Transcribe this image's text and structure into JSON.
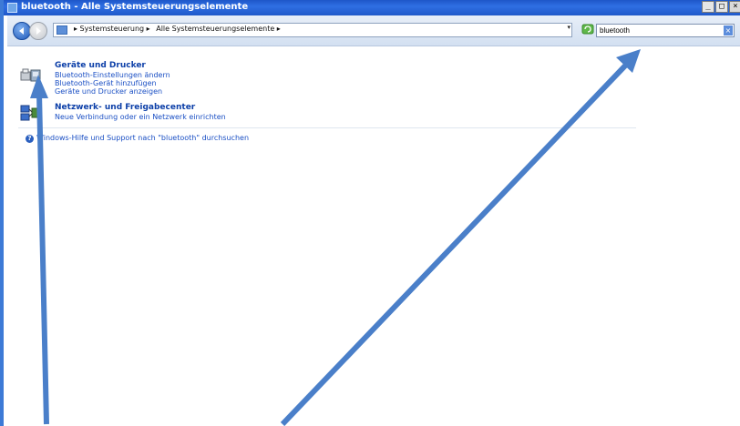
{
  "window": {
    "title": "bluetooth - Alle Systemsteuerungselemente",
    "buttons": [
      "_",
      "□",
      "×"
    ]
  },
  "toolbar": {
    "breadcrumbs": [
      "▸ Systemsteuerung ▸",
      "Alle Systemsteuerungselemente ▸"
    ],
    "dropdown": "▾",
    "search_value": "bluetooth",
    "search_clear": "×"
  },
  "results": [
    {
      "title": "Geräte und Drucker",
      "links": [
        "Bluetooth-Einstellungen ändern",
        "Bluetooth-Gerät hinzufügen",
        "Geräte und Drucker anzeigen"
      ],
      "icon": "devices-printers-icon"
    },
    {
      "title": "Netzwerk- und Freigabecenter",
      "links": [
        "Neue Verbindung oder ein Netzwerk einrichten"
      ],
      "icon": "network-center-icon"
    }
  ],
  "help": {
    "text": "Windows-Hilfe und Support nach \"bluetooth\" durchsuchen",
    "icon": "help-icon"
  },
  "colors": {
    "title_bar": "#2f6fe3",
    "link": "#1a4fc4",
    "heading": "#0c3fa8",
    "arrow": "#4a7fc9"
  }
}
